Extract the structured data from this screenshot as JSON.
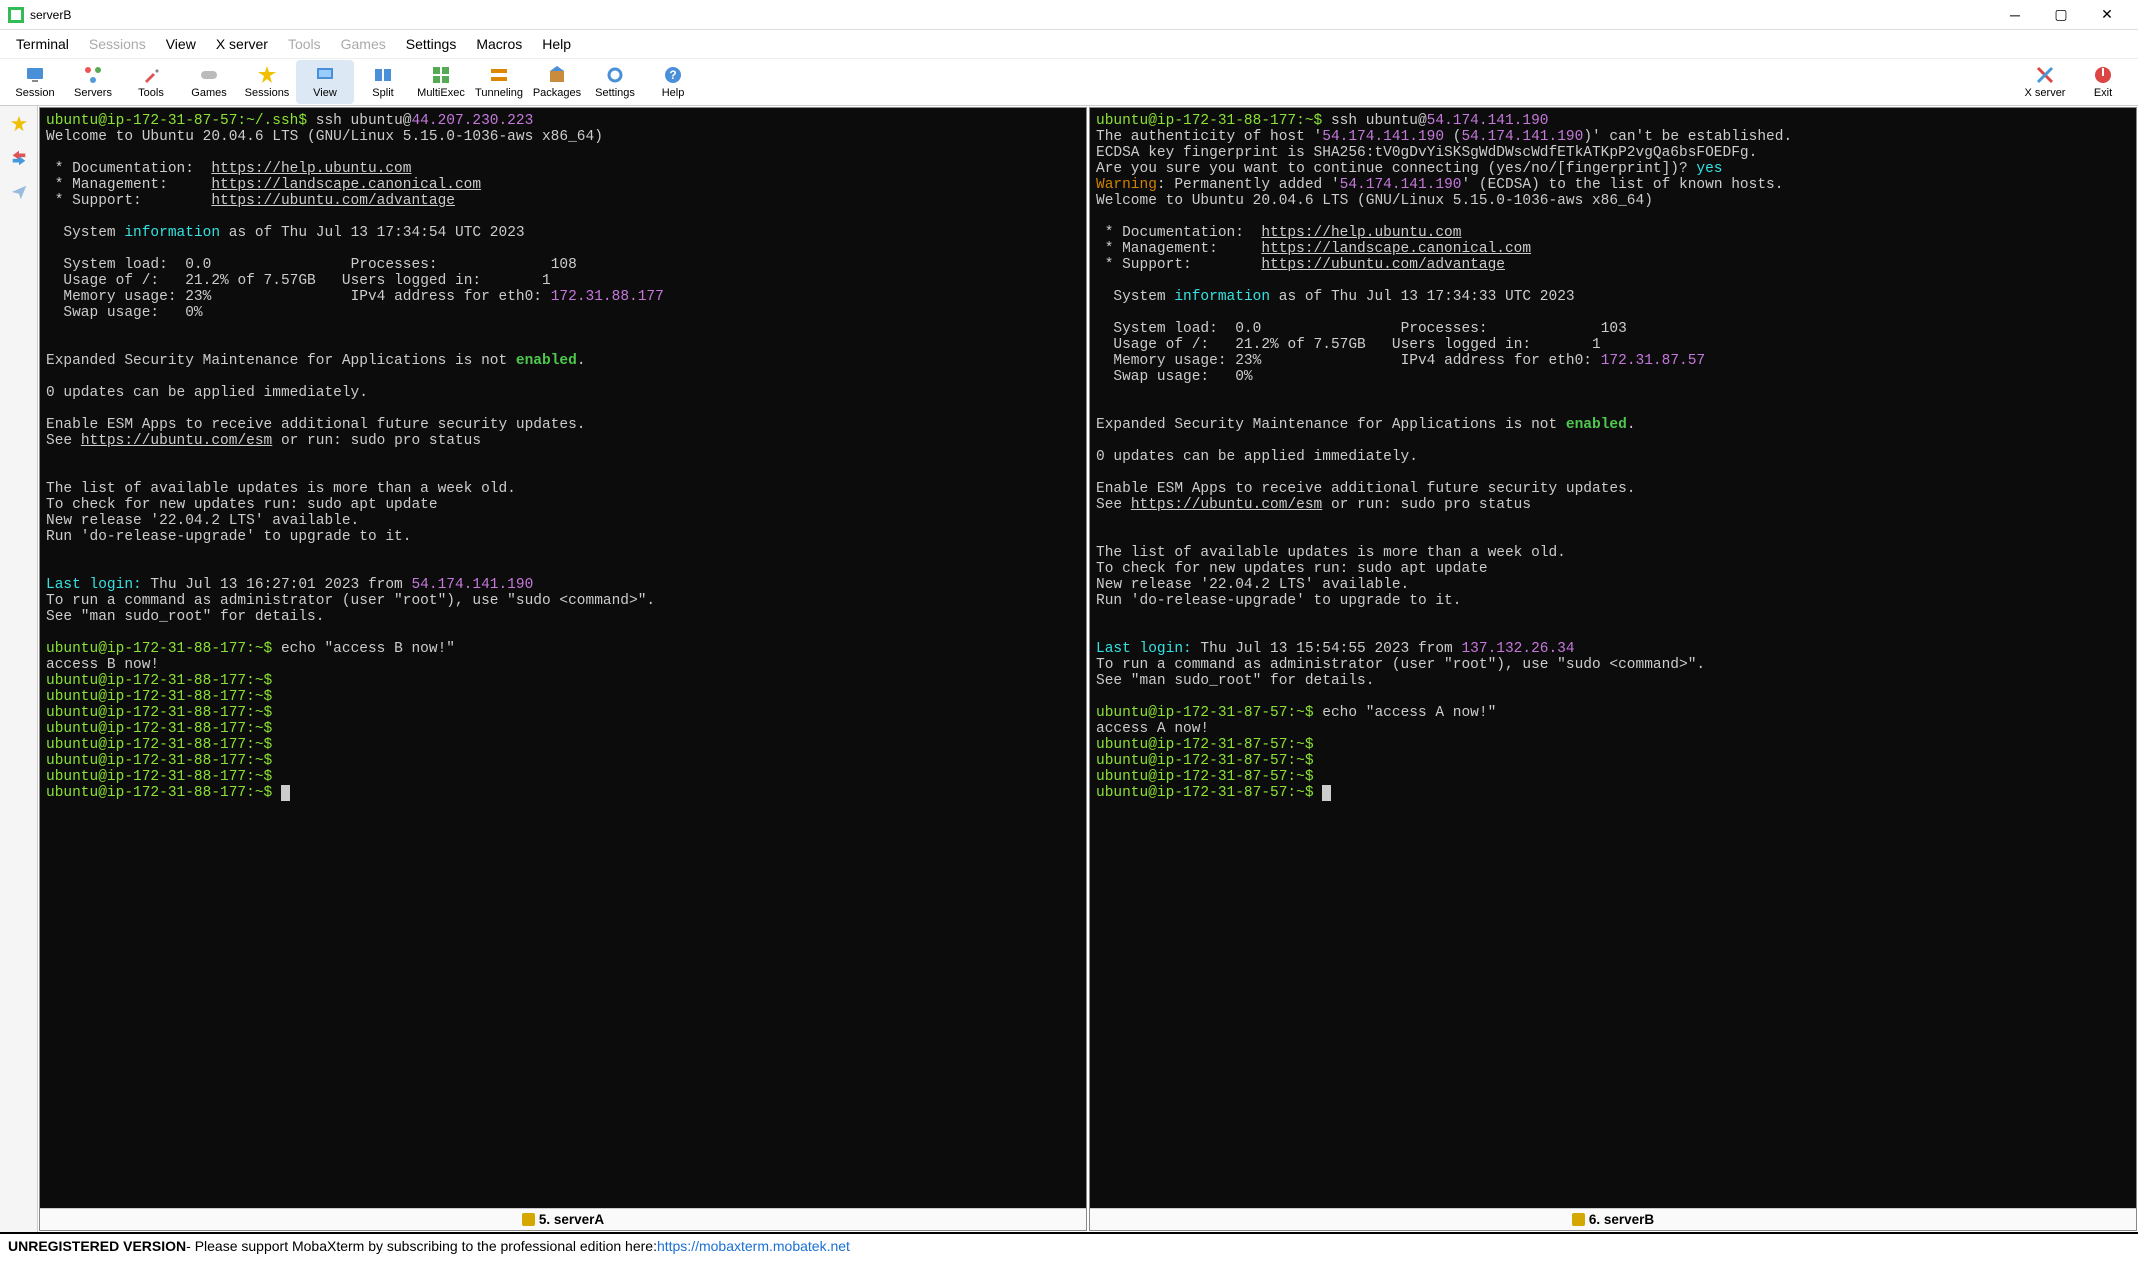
{
  "window": {
    "title": "serverB"
  },
  "menubar": [
    "Terminal",
    "Sessions",
    "View",
    "X server",
    "Tools",
    "Games",
    "Settings",
    "Macros",
    "Help"
  ],
  "menubar_disabled": [
    1,
    4,
    5
  ],
  "toolbar": {
    "left": [
      {
        "label": "Session",
        "icon": "screen"
      },
      {
        "label": "Servers",
        "icon": "servers"
      },
      {
        "label": "Tools",
        "icon": "tools"
      },
      {
        "label": "Games",
        "icon": "games"
      },
      {
        "label": "Sessions",
        "icon": "star"
      },
      {
        "label": "View",
        "icon": "view",
        "highlight": true
      },
      {
        "label": "Split",
        "icon": "split"
      },
      {
        "label": "MultiExec",
        "icon": "multiexec"
      },
      {
        "label": "Tunneling",
        "icon": "tunneling"
      },
      {
        "label": "Packages",
        "icon": "packages"
      },
      {
        "label": "Settings",
        "icon": "settings"
      },
      {
        "label": "Help",
        "icon": "help"
      }
    ],
    "right": [
      {
        "label": "X server",
        "icon": "xserver"
      },
      {
        "label": "Exit",
        "icon": "exit"
      }
    ]
  },
  "sidebar": [
    "star",
    "arrows",
    "plane"
  ],
  "tabs": {
    "left": "5. serverA",
    "right": "6. serverB"
  },
  "left_pane": {
    "prompt_host1": "ubuntu@ip-172-31-87-57:~/.ssh$",
    "ssh_cmd": "ssh ubuntu@",
    "ssh_ip": "44.207.230.223",
    "welcome": "Welcome to Ubuntu 20.04.6 LTS (GNU/Linux 5.15.0-1036-aws x86_64)",
    "doc_url": "https://help.ubuntu.com",
    "mgmt_url": "https://landscape.canonical.com",
    "sup_url": "https://ubuntu.com/advantage",
    "sysinfo_date": "as of Thu Jul 13 17:34:54 UTC 2023",
    "stats": {
      "load": "0.0",
      "processes": "108",
      "usage": "21.2% of 7.57GB",
      "users": "1",
      "mem": "23%",
      "ipv4": "172.31.88.177",
      "swap": "0%"
    },
    "enabled_word": "enabled",
    "esm_url": "https://ubuntu.com/esm",
    "last_login_ip": "54.174.141.190",
    "last_login_time": "Thu Jul 13 16:27:01 2023 from",
    "prompt_host2": "ubuntu@ip-172-31-88-177:~$",
    "echo_cmd": "echo \"access B now!\"",
    "echo_out": "access B now!"
  },
  "right_pane": {
    "prompt_host": "ubuntu@ip-172-31-88-177:~$",
    "ssh_cmd": "ssh ubuntu@",
    "ssh_ip": "54.174.141.190",
    "auth1a": "The authenticity of host '",
    "auth1b": "54.174.141.190",
    "auth1c": " (",
    "auth1d": "54.174.141.190",
    "auth1e": ")' can't be established.",
    "auth2": "ECDSA key fingerprint is SHA256:tV0gDvYiSKSgWdDWscWdfETkATKpP2vgQa6bsFOEDFg.",
    "auth3a": "Are you sure you want to continue connecting (yes/no/[fingerprint])? ",
    "auth3b": "yes",
    "warn_a": "Warning",
    "warn_b": ": Permanently added '",
    "warn_c": "54.174.141.190",
    "warn_d": "' (ECDSA) to the list of known hosts.",
    "welcome": "Welcome to Ubuntu 20.04.6 LTS (GNU/Linux 5.15.0-1036-aws x86_64)",
    "doc_url": "https://help.ubuntu.com",
    "mgmt_url": "https://landscape.canonical.com",
    "sup_url": "https://ubuntu.com/advantage",
    "sysinfo_date": "as of Thu Jul 13 17:34:33 UTC 2023",
    "stats": {
      "load": "0.0",
      "processes": "103",
      "usage": "21.2% of 7.57GB",
      "users": "1",
      "mem": "23%",
      "ipv4": "172.31.87.57",
      "swap": "0%"
    },
    "enabled_word": "enabled",
    "esm_url": "https://ubuntu.com/esm",
    "last_login_ip": "137.132.26.34",
    "last_login_time": "Thu Jul 13 15:54:55 2023 from",
    "prompt_host2": "ubuntu@ip-172-31-87-57:~$",
    "echo_cmd": "echo \"access A now!\"",
    "echo_out": "access A now!"
  },
  "common_text": {
    "doc": " * Documentation:  ",
    "mgmt": " * Management:     ",
    "sup": " * Support:        ",
    "sysinfo": "  System ",
    "information": "information",
    "sysload": "  System load:  ",
    "usage": "  Usage of /:   ",
    "memuse": "  Memory usage: ",
    "swap": "  Swap usage:   ",
    "proc": "Processes:             ",
    "users": "Users logged in:       ",
    "ipv4": "IPv4 address for eth0: ",
    "esm": "Expanded Security Maintenance for Applications is not ",
    "updates": "0 updates can be applied immediately.",
    "enable_esm": "Enable ESM Apps to receive additional future security updates.",
    "see": "See ",
    "or_run": " or run: sudo pro status",
    "listold": "The list of available updates is more than a week old.",
    "checknew": "To check for new updates run: sudo apt update",
    "newrel": "New release '22.04.2 LTS' available.",
    "upgrade": "Run 'do-release-upgrade' to upgrade to it.",
    "lastlogin": "Last login:",
    "torun": "To run a command as administrator (user \"root\"), use \"sudo <command>\".",
    "seesudo": "See \"man sudo_root\" for details."
  },
  "statusbar": {
    "version": "UNREGISTERED VERSION",
    "text": " -  Please support MobaXterm by subscribing to the professional edition here:  ",
    "link": "https://mobaxterm.mobatek.net"
  }
}
